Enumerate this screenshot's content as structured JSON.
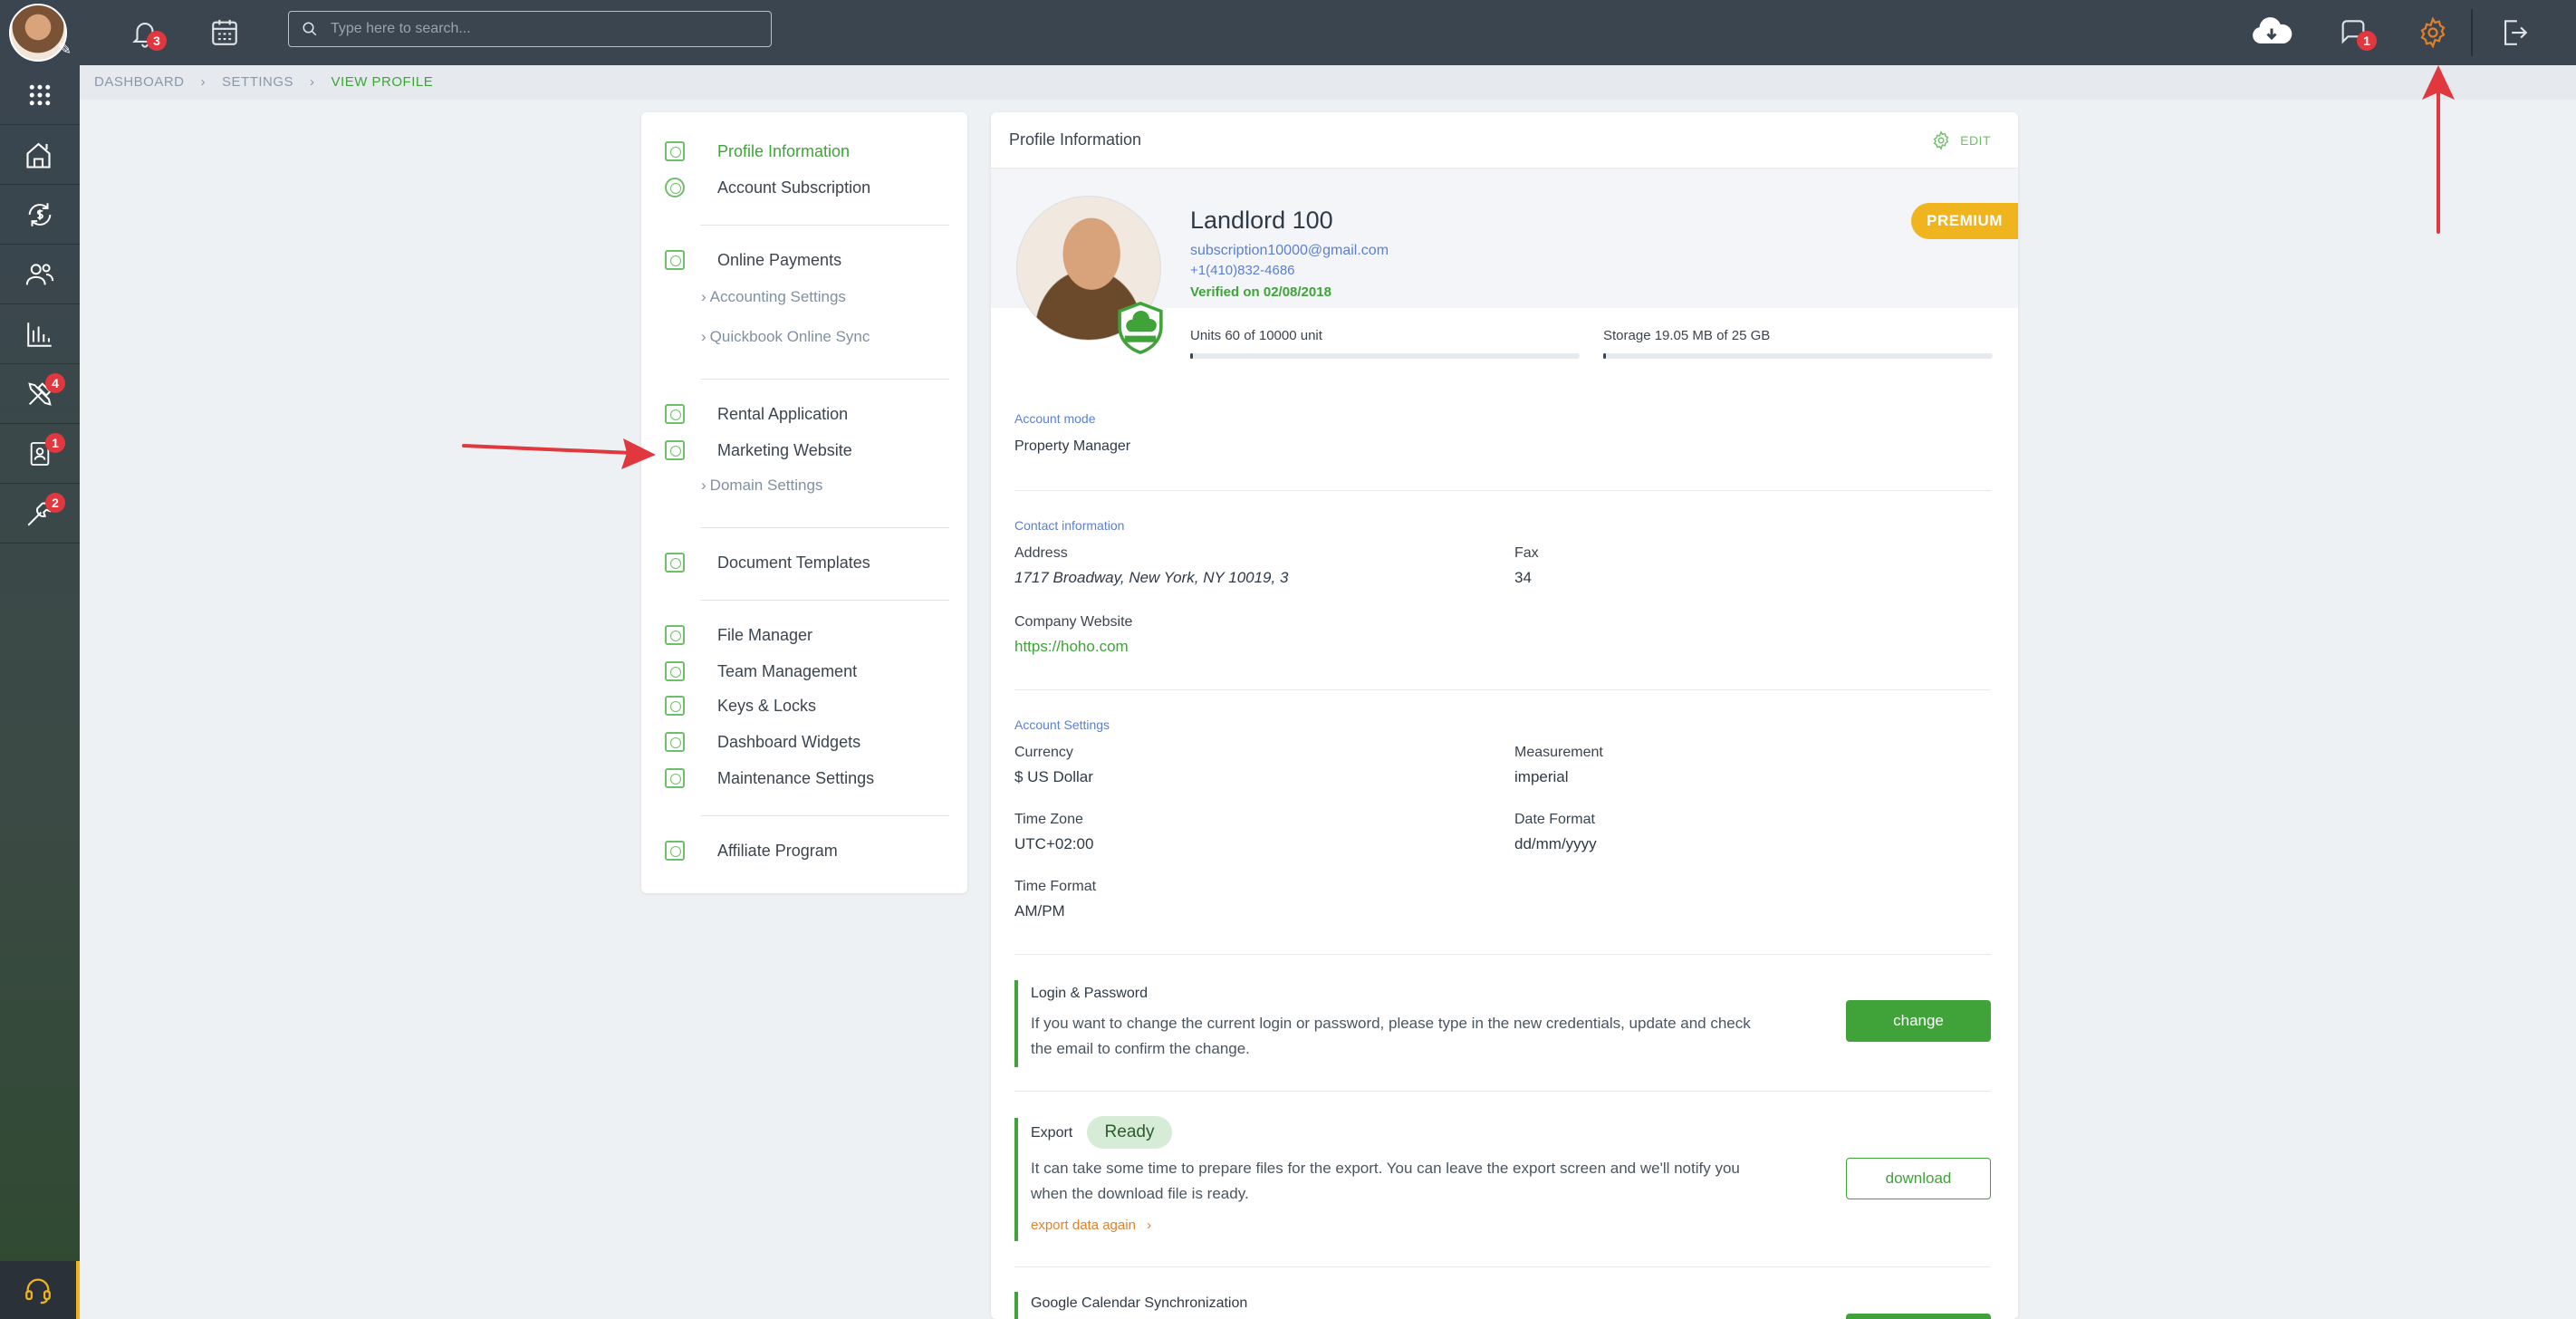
{
  "topbar": {
    "search_placeholder": "Type here to search...",
    "notifications_count": "3",
    "messages_count": "1"
  },
  "sidebar": {
    "items": [
      {
        "icon": "apps-grid-icon",
        "badge": ""
      },
      {
        "icon": "home-building-icon",
        "badge": ""
      },
      {
        "icon": "dollar-cycle-icon",
        "badge": ""
      },
      {
        "icon": "people-icon",
        "badge": ""
      },
      {
        "icon": "bar-chart-icon",
        "badge": ""
      },
      {
        "icon": "tools-icon",
        "badge": "4"
      },
      {
        "icon": "contact-card-icon",
        "badge": "1"
      },
      {
        "icon": "wrench-icon",
        "badge": "2"
      }
    ]
  },
  "breadcrumb": {
    "items": [
      "DASHBOARD",
      "SETTINGS",
      "VIEW PROFILE"
    ]
  },
  "menu": {
    "profile_information": "Profile Information",
    "account_subscription": "Account Subscription",
    "online_payments": "Online Payments",
    "accounting_settings": "Accounting Settings",
    "quickbook_online_sync": "Quickbook Online Sync",
    "rental_application": "Rental Application",
    "marketing_website": "Marketing Website",
    "domain_settings": "Domain Settings",
    "document_templates": "Document Templates",
    "file_manager": "File Manager",
    "team_management": "Team Management",
    "keys_locks": "Keys & Locks",
    "dashboard_widgets": "Dashboard Widgets",
    "maintenance_settings": "Maintenance Settings",
    "affiliate_program": "Affiliate Program"
  },
  "profile": {
    "card_title": "Profile Information",
    "edit_label": "EDIT",
    "name": "Landlord 100",
    "email": "subscription10000@gmail.com",
    "phone": "+1(410)832-4686",
    "verified": "Verified on 02/08/2018",
    "plan_badge": "PREMIUM",
    "units_label": "Units 60 of 10000 unit",
    "units_fraction": 0.006,
    "storage_label": "Storage 19.05 MB of 25 GB",
    "storage_fraction": 0.0008
  },
  "account_mode": {
    "section": "Account mode",
    "value": "Property Manager"
  },
  "contact": {
    "section": "Contact information",
    "address_label": "Address",
    "address_value": "1717 Broadway, New York, NY 10019, 3",
    "fax_label": "Fax",
    "fax_value": "34",
    "website_label": "Company Website",
    "website_value": "https://hoho.com"
  },
  "account_settings": {
    "section": "Account Settings",
    "currency_label": "Currency",
    "currency_value": "$ US Dollar",
    "measurement_label": "Measurement",
    "measurement_value": "imperial",
    "timezone_label": "Time Zone",
    "timezone_value": "UTC+02:00",
    "dateformat_label": "Date Format",
    "dateformat_value": "dd/mm/yyyy",
    "timeformat_label": "Time Format",
    "timeformat_value": "AM/PM"
  },
  "login": {
    "title": "Login & Password",
    "description": "If you want to change the current login or password, please type in the new credentials, update and check the email to confirm the change.",
    "button": "change"
  },
  "export": {
    "title": "Export",
    "status": "Ready",
    "description": "It can take some time to prepare files for the export. You can leave the export screen and we'll notify you when the download file is ready.",
    "again_link": "export data again",
    "button": "download"
  },
  "gcal": {
    "title": "Google Calendar Synchronization"
  },
  "colors": {
    "topbar": "#3a4550",
    "accent_green": "#3fa33a",
    "premium_yellow": "#f0b41e",
    "link_blue": "#5c7fd0",
    "badge_red": "#e0383e",
    "arrow_red": "#e0383e",
    "settings_orange": "#e0802a"
  }
}
